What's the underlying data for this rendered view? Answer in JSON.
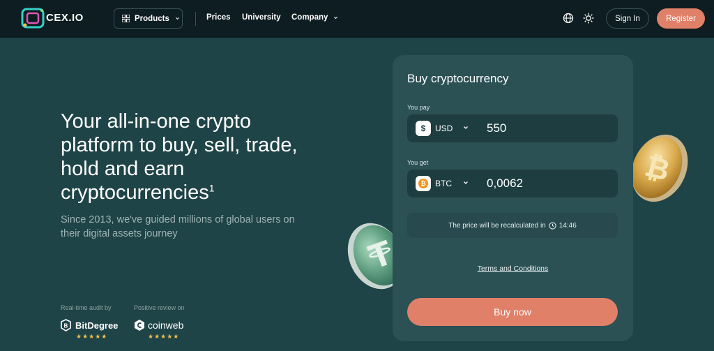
{
  "header": {
    "logo_text": "CEX.IO",
    "products_label": "Products",
    "nav": [
      "Prices",
      "University",
      "Company"
    ],
    "signin_label": "Sign In",
    "register_label": "Register",
    "icons": [
      "grid-icon",
      "globe-icon",
      "sun-icon"
    ]
  },
  "hero": {
    "title": "Your all-in-one crypto platform to buy, sell, trade, hold and earn cryptocurrencies",
    "title_sup": "1",
    "subtitle": "Since 2013, we've guided millions of global users on their digital assets journey",
    "audit_label": "Real-time audit by",
    "review_label": "Positive review on",
    "badge1_name": "BitDegree",
    "badge2_name": "coinweb",
    "stars": "★★★★★"
  },
  "card": {
    "title": "Buy cryptocurrency",
    "pay_label": "You pay",
    "pay_currency": "USD",
    "pay_symbol": "$",
    "pay_amount": "550",
    "get_label": "You get",
    "get_currency": "BTC",
    "get_symbol": "₿",
    "get_amount": "0,0062",
    "recalc_text": "The price will be recalculated in",
    "recalc_time": "14:46",
    "terms_label": "Terms and Conditions",
    "buy_label": "Buy now"
  },
  "colors": {
    "background": "#1f4447",
    "header": "#0d1d21",
    "card": "#2b5155",
    "field": "#1d3d41",
    "accent": "#e08068",
    "btc": "#f7931a"
  }
}
